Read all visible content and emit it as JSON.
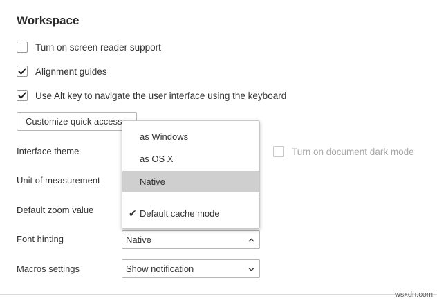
{
  "section": {
    "title": "Workspace"
  },
  "checkboxes": {
    "screen_reader": {
      "label": "Turn on screen reader support",
      "checked": false
    },
    "alignment_guides": {
      "label": "Alignment guides",
      "checked": true
    },
    "alt_key": {
      "label": "Use Alt key to navigate the user interface using the keyboard",
      "checked": true
    },
    "dark_mode": {
      "label": "Turn on document dark mode",
      "checked": false,
      "disabled": true
    }
  },
  "buttons": {
    "customize_quick_access": "Customize quick access"
  },
  "rows": {
    "interface_theme": "Interface theme",
    "unit_of_measurement": "Unit of measurement",
    "default_zoom": "Default zoom value",
    "font_hinting": "Font hinting",
    "macros_settings": "Macros settings"
  },
  "selects": {
    "font_hinting": {
      "value": "Native",
      "expanded": true
    },
    "macros_settings": {
      "value": "Show notification",
      "expanded": false
    }
  },
  "dropdown": {
    "options": [
      "as Windows",
      "as OS X",
      "Native"
    ],
    "selected": "Native",
    "extra_option": {
      "label": "Default cache mode",
      "checked": true
    }
  },
  "colors": {
    "text": "#333333",
    "border": "#b5b5b5",
    "highlight": "#cfcfcf",
    "disabled_text": "#a8a8a8"
  },
  "watermark": "wsxdn.com"
}
